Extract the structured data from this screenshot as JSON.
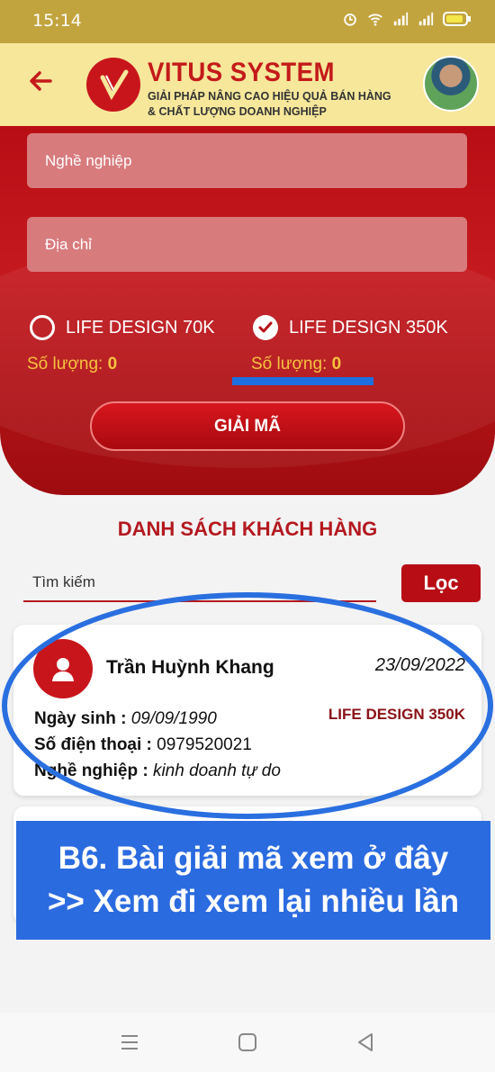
{
  "status_bar": {
    "time": "15:14",
    "icons": [
      "alarm-icon",
      "wifi-icon",
      "signal-icon",
      "signal-icon",
      "battery-icon"
    ]
  },
  "header": {
    "brand_name": "VITUS SYSTEM",
    "tagline_1": "GIẢI PHÁP NÂNG CAO HIỆU QUẢ BÁN HÀNG",
    "tagline_2": "& CHẤT LƯỢNG DOANH NGHIỆP"
  },
  "form": {
    "occupation_placeholder": "Nghề nghiệp",
    "address_placeholder": "Địa chỉ",
    "option_1": {
      "label": "LIFE DESIGN 70K",
      "selected": false,
      "qty_label": "Số lượng:",
      "qty_value": "0"
    },
    "option_2": {
      "label": "LIFE DESIGN 350K",
      "selected": true,
      "qty_label": "Số lượng:",
      "qty_value": "0"
    },
    "decode_button": "GIẢI MÃ"
  },
  "list": {
    "title": "DANH SÁCH KHÁCH HÀNG",
    "search_placeholder": "Tìm kiếm",
    "filter_button": "Lọc",
    "customers": [
      {
        "name": "Trần Huỳnh Khang",
        "date": "23/09/2022",
        "package": "LIFE DESIGN 350K",
        "dob_label": "Ngày sinh :",
        "dob": "09/09/1990",
        "phone_label": "Số điện thoại :",
        "phone": "0979520021",
        "job_label": "Nghề nghiệp :",
        "job": "kinh doanh tự do"
      }
    ]
  },
  "annotation": {
    "line_1": "B6. Bài giải mã xem ở đây",
    "line_2": ">> Xem đi xem lại nhiều lần"
  },
  "colors": {
    "primary_red": "#b80d14",
    "header_yellow": "#f6e79b",
    "accent_blue": "#2b6be0",
    "qty_yellow": "#f6c23e"
  }
}
